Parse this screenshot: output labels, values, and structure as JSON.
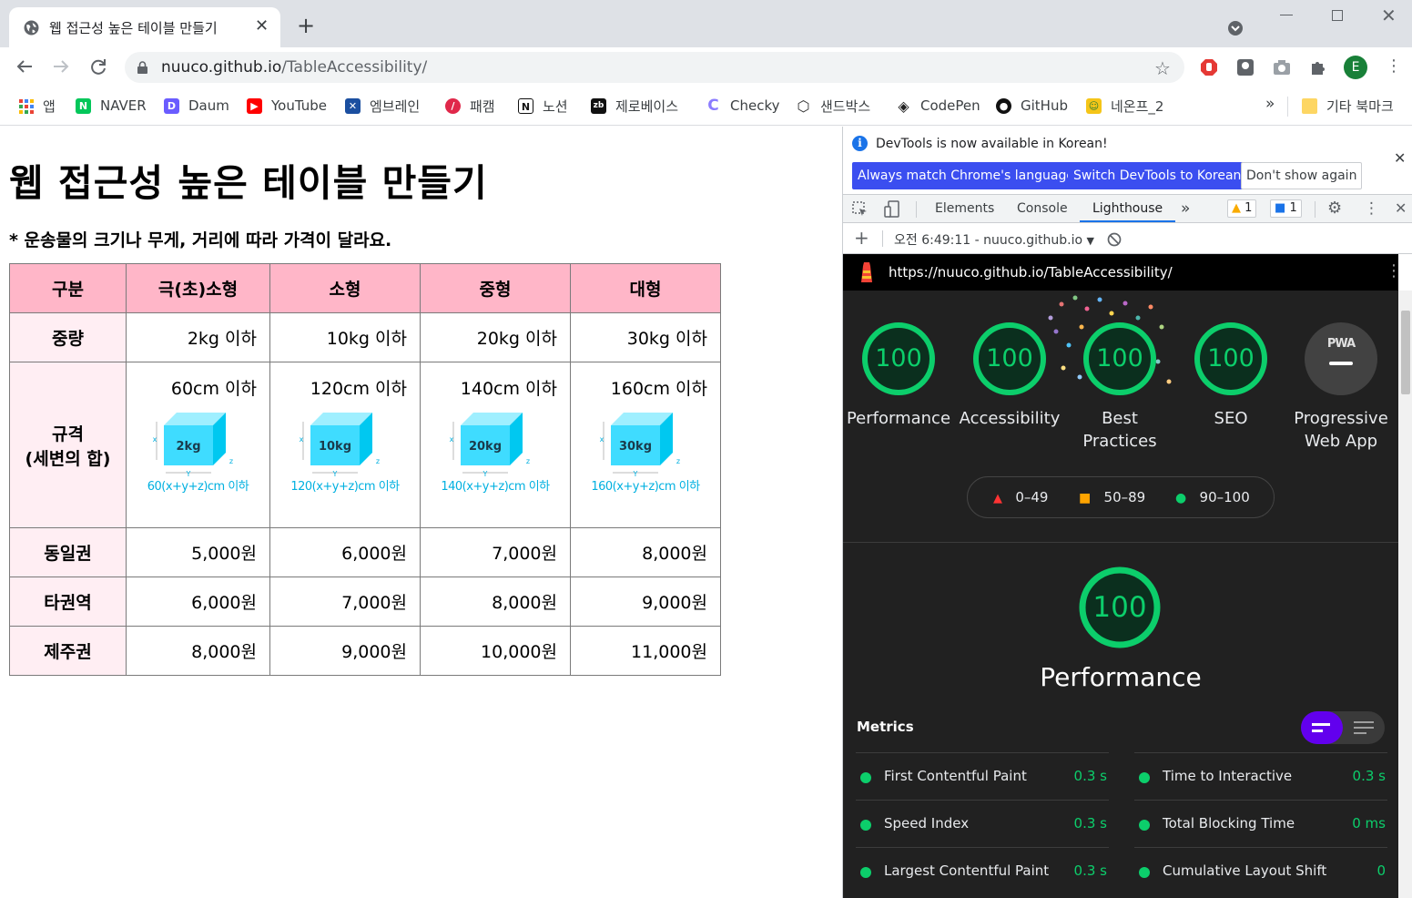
{
  "browser": {
    "tab_title": "웹 접근성 높은 테이블 만들기",
    "url_host": "nuuco.github.io",
    "url_path": "/TableAccessibility/",
    "avatar_letter": "E"
  },
  "bookmarks": [
    {
      "label": "앱",
      "icon": "apps-grid-icon",
      "color": "#ea4335"
    },
    {
      "label": "NAVER",
      "icon": "naver-icon",
      "color": "#03c75a"
    },
    {
      "label": "Daum",
      "icon": "daum-icon",
      "color": "#6a5cff"
    },
    {
      "label": "YouTube",
      "icon": "youtube-icon",
      "color": "#ff0000"
    },
    {
      "label": "엠브레인",
      "icon": "embrain-icon",
      "color": "#1b4fa0"
    },
    {
      "label": "패캠",
      "icon": "fastcampus-icon",
      "color": "#e0284a"
    },
    {
      "label": "노션",
      "icon": "notion-icon",
      "color": "#111111"
    },
    {
      "label": "제로베이스",
      "icon": "zerobase-icon",
      "color": "#111111"
    },
    {
      "label": "Checky",
      "icon": "checky-icon",
      "color": "#8b7cff"
    },
    {
      "label": "샌드박스",
      "icon": "codesandbox-icon",
      "color": "#333333"
    },
    {
      "label": "CodePen",
      "icon": "codepen-icon",
      "color": "#222222"
    },
    {
      "label": "GitHub",
      "icon": "github-icon",
      "color": "#111111"
    },
    {
      "label": "네온프_2",
      "icon": "neon-icon",
      "color": "#f5c518"
    }
  ],
  "bookmarks_more": "»",
  "bookmarks_other": "기타 북마크",
  "page": {
    "title": "웹 접근성 높은 테이블 만들기",
    "note": "* 운송물의 크기나 무게, 거리에 따라 가격이 달라요.",
    "table": {
      "headers": [
        "구분",
        "극(초)소형",
        "소형",
        "중형",
        "대형"
      ],
      "weight_row": {
        "label": "중량",
        "cells": [
          "2kg 이하",
          "10kg 이하",
          "20kg 이하",
          "30kg 이하"
        ]
      },
      "spec_row": {
        "label_line1": "규격",
        "label_line2": "(세변의 합)",
        "cells": [
          {
            "size": "60cm 이하",
            "box_label": "2kg",
            "caption": "60(x+y+z)cm 이하"
          },
          {
            "size": "120cm 이하",
            "box_label": "10kg",
            "caption": "120(x+y+z)cm 이하"
          },
          {
            "size": "140cm 이하",
            "box_label": "20kg",
            "caption": "140(x+y+z)cm 이하"
          },
          {
            "size": "160cm 이하",
            "box_label": "30kg",
            "caption": "160(x+y+z)cm 이하"
          }
        ],
        "axis_x": "x",
        "axis_y": "Y",
        "axis_z": "z"
      },
      "price_rows": [
        {
          "label": "동일권",
          "cells": [
            "5,000원",
            "6,000원",
            "7,000원",
            "8,000원"
          ]
        },
        {
          "label": "타권역",
          "cells": [
            "6,000원",
            "7,000원",
            "8,000원",
            "9,000원"
          ]
        },
        {
          "label": "제주권",
          "cells": [
            "8,000원",
            "9,000원",
            "10,000원",
            "11,000원"
          ]
        }
      ]
    }
  },
  "devtools": {
    "infobar_text": "DevTools is now available in Korean!",
    "btn_match": "Always match Chrome's language",
    "btn_switch": "Switch DevTools to Korean",
    "btn_dont_show": "Don't show again",
    "tabs": [
      "Elements",
      "Console",
      "Lighthouse"
    ],
    "active_tab": "Lighthouse",
    "warning_count": "1",
    "message_count": "1",
    "report_select": "오전 6:49:11 - nuuco.github.io",
    "lighthouse": {
      "url": "https://nuuco.github.io/TableAccessibility/",
      "gauges": [
        {
          "label": "Performance",
          "score": "100"
        },
        {
          "label": "Accessibility",
          "score": "100"
        },
        {
          "label_line1": "Best",
          "label_line2": "Practices",
          "score": "100"
        },
        {
          "label": "SEO",
          "score": "100"
        },
        {
          "label_line1": "Progressive",
          "label_line2": "Web App",
          "badge": "PWA"
        }
      ],
      "legend": [
        "0–49",
        "50–89",
        "90–100"
      ],
      "perf_score": "100",
      "perf_label": "Performance",
      "metrics_title": "Metrics",
      "metrics": [
        {
          "name": "First Contentful Paint",
          "value": "0.3 s"
        },
        {
          "name": "Time to Interactive",
          "value": "0.3 s"
        },
        {
          "name": "Speed Index",
          "value": "0.3 s"
        },
        {
          "name": "Total Blocking Time",
          "value": "0 ms"
        },
        {
          "name": "Largest Contentful Paint",
          "value": "0.3 s"
        },
        {
          "name": "Cumulative Layout Shift",
          "value": "0"
        }
      ],
      "colors": {
        "pass": "#0cce6b",
        "average": "#ffa400",
        "fail": "#ff3333"
      }
    }
  }
}
